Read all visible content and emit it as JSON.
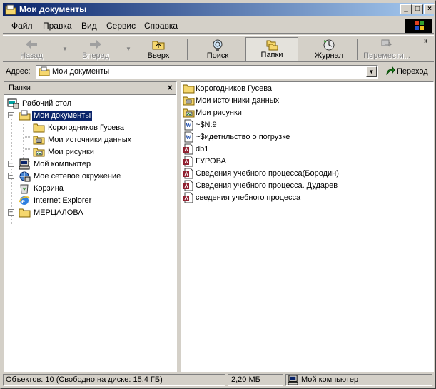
{
  "window": {
    "title": "Мои документы"
  },
  "menu": [
    "Файл",
    "Правка",
    "Вид",
    "Сервис",
    "Справка"
  ],
  "toolbar": {
    "back": "Назад",
    "forward": "Вперед",
    "up": "Вверх",
    "search": "Поиск",
    "folders": "Папки",
    "history": "Журнал",
    "move": "Перемести..."
  },
  "address": {
    "label": "Адрес:",
    "value": "Мои документы",
    "go": "Переход"
  },
  "folders_pane": {
    "title": "Папки",
    "close": "×",
    "tree": [
      {
        "label": "Рабочий стол",
        "icon": "desktop-icon"
      },
      {
        "label": "Мои документы",
        "icon": "my-documents-icon",
        "selected": true,
        "expander": "−"
      },
      {
        "label": "Корогодников Гусева",
        "icon": "folder-icon"
      },
      {
        "label": "Мои источники данных",
        "icon": "data-sources-folder-icon"
      },
      {
        "label": "Мои рисунки",
        "icon": "pictures-folder-icon"
      },
      {
        "label": "Мой компьютер",
        "icon": "my-computer-icon",
        "expander": "+"
      },
      {
        "label": "Мое сетевое окружение",
        "icon": "network-icon",
        "expander": "+"
      },
      {
        "label": "Корзина",
        "icon": "recycle-bin-icon"
      },
      {
        "label": "Internet Explorer",
        "icon": "internet-explorer-icon"
      },
      {
        "label": "МЕРЦАЛОВА",
        "icon": "folder-icon",
        "expander": "+"
      }
    ]
  },
  "files": [
    {
      "name": "Корогодников Гусева",
      "icon": "folder-icon"
    },
    {
      "name": "Мои источники данных",
      "icon": "data-sources-folder-icon"
    },
    {
      "name": "Мои рисунки",
      "icon": "pictures-folder-icon"
    },
    {
      "name": "~$N:9",
      "icon": "word-doc-icon"
    },
    {
      "name": "~$идетнльство о погрузке",
      "icon": "word-doc-icon"
    },
    {
      "name": "db1",
      "icon": "access-db-icon"
    },
    {
      "name": "ГУРОВА",
      "icon": "access-db-icon"
    },
    {
      "name": "Сведения учебного процесса(Бородин)",
      "icon": "access-db-icon"
    },
    {
      "name": "Сведения учебного процесса. Дударев",
      "icon": "access-db-icon"
    },
    {
      "name": "сведения учебного процесса",
      "icon": "access-db-icon"
    }
  ],
  "status": {
    "objects": "Объектов: 10 (Свободно на диске: 15,4 ГБ)",
    "size": "2,20 МБ",
    "location": "Мой компьютер"
  }
}
